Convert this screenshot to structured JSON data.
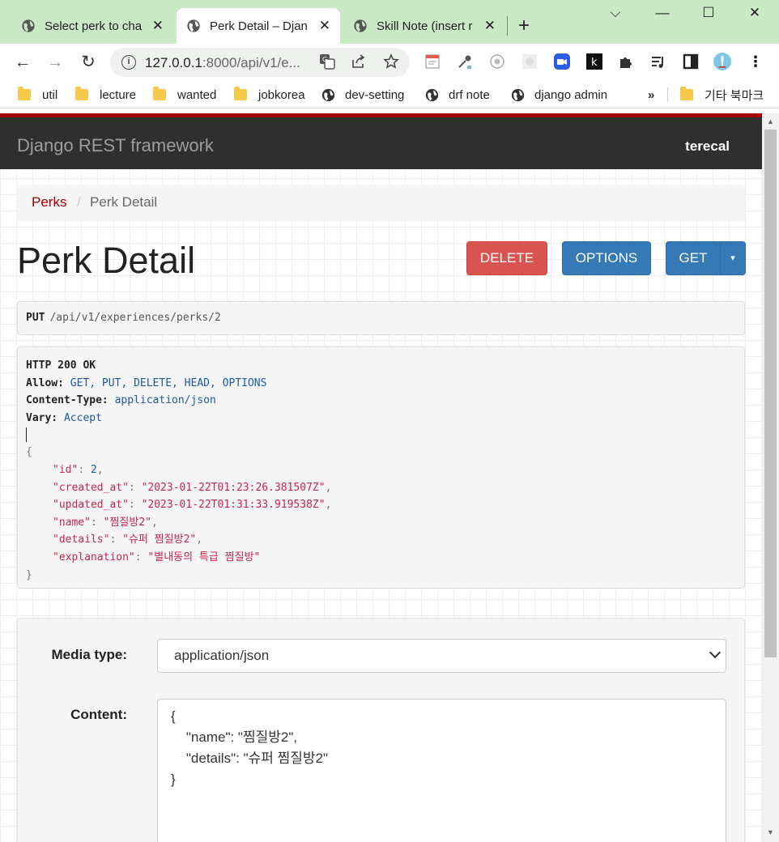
{
  "browser": {
    "tabs": [
      {
        "title": "Select perk to cha",
        "active": false
      },
      {
        "title": "Perk Detail – Djan",
        "active": true
      },
      {
        "title": "Skill Note (insert r",
        "active": false
      }
    ],
    "new_tab": "+",
    "window_controls": [
      "⌵",
      "—",
      "☐",
      "✕"
    ],
    "url_host": "127.0.0.1",
    "url_rest": ":8000/api/v1/e...",
    "extensions": [
      "google-translate-icon",
      "share-icon",
      "star-icon",
      "memo-icon",
      "eyedropper-icon",
      "record-icon",
      "grid-icon",
      "zoom-icon",
      "k-icon",
      "puzzle-icon",
      "media-icon",
      "sidepanel-icon",
      "profile-icon",
      "menu-icon"
    ],
    "ext_k": "k",
    "bookmarks": [
      {
        "label": "util",
        "type": "folder"
      },
      {
        "label": "lecture",
        "type": "folder"
      },
      {
        "label": "wanted",
        "type": "folder"
      },
      {
        "label": "jobkorea",
        "type": "folder"
      },
      {
        "label": "dev-setting",
        "type": "site"
      },
      {
        "label": "drf note",
        "type": "site"
      },
      {
        "label": "django admin",
        "type": "site"
      }
    ],
    "bookmarks_overflow": "»",
    "other_bookmarks": "기타 북마크"
  },
  "navbar": {
    "brand": "Django REST framework",
    "user": "terecal"
  },
  "breadcrumb": {
    "link": "Perks",
    "separator": "/",
    "active": "Perk Detail"
  },
  "page": {
    "title": "Perk Detail",
    "buttons": {
      "delete": "DELETE",
      "options": "OPTIONS",
      "get": "GET",
      "caret": "▾"
    }
  },
  "request": {
    "method": "PUT",
    "path": "/api/v1/experiences/perks/2"
  },
  "response": {
    "status": "HTTP 200 OK",
    "headers": [
      {
        "key": "Allow:",
        "value": "GET, PUT, DELETE, HEAD, OPTIONS"
      },
      {
        "key": "Content-Type:",
        "value": "application/json"
      },
      {
        "key": "Vary:",
        "value": "Accept"
      }
    ],
    "open_brace": "{",
    "close_brace": "}",
    "fields": [
      {
        "key": "\"id\"",
        "value": "2",
        "kind": "num",
        "comma": ","
      },
      {
        "key": "\"created_at\"",
        "value": "\"2023-01-22T01:23:26.381507Z\"",
        "kind": "str",
        "comma": ","
      },
      {
        "key": "\"updated_at\"",
        "value": "\"2023-01-22T01:31:33.919538Z\"",
        "kind": "str",
        "comma": ","
      },
      {
        "key": "\"name\"",
        "value": "\"찜질방2\"",
        "kind": "str",
        "comma": ","
      },
      {
        "key": "\"details\"",
        "value": "\"슈퍼 찜질방2\"",
        "kind": "str",
        "comma": ","
      },
      {
        "key": "\"explanation\"",
        "value": "\"별내동의 특급 찜질방\"",
        "kind": "str",
        "comma": ""
      }
    ]
  },
  "form": {
    "media_type_label": "Media type:",
    "media_type_value": "application/json",
    "content_label": "Content:",
    "content_value": "{\n    \"name\": \"찜질방2\",\n    \"details\": \"슈퍼 찜질방2\"\n}"
  }
}
